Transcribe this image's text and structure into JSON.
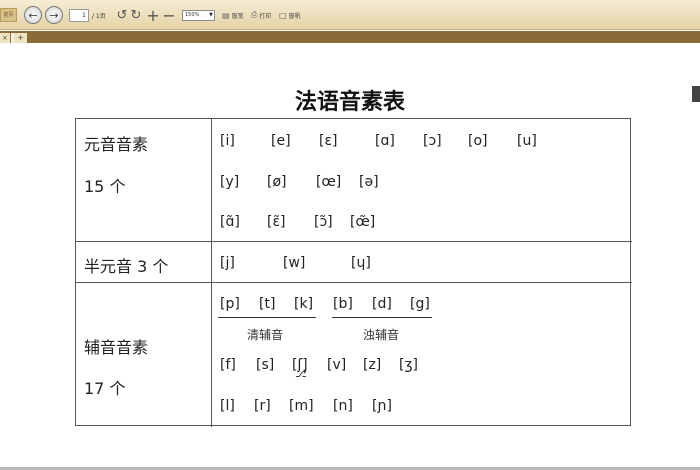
{
  "toolbar": {
    "prev_label": "前页",
    "page_input": "1",
    "page_total": "/ 1页",
    "zoom": "150%",
    "fit_label": "窗宽",
    "print_label": "打印",
    "fullscreen_label": "窗帆"
  },
  "tabs": {
    "close": "×",
    "add": "+"
  },
  "document": {
    "title": "法语音素表",
    "rows": [
      {
        "label": "元音音素",
        "count": "15 个",
        "lines": [
          [
            "[i]",
            "[e]",
            "[ɛ]",
            "[ɑ]",
            "[ɔ]",
            "[o]",
            "[u]"
          ],
          [
            "[y]",
            "[ø]",
            "[œ]",
            "[ə]"
          ],
          [
            "[ɑ̃]",
            "[ɛ̃]",
            "[ɔ̃]",
            "[œ̃]"
          ]
        ]
      },
      {
        "label": "半元音 3 个",
        "lines": [
          [
            "[j]",
            "[w]",
            "[ɥ]"
          ]
        ]
      },
      {
        "label": "辅音音素",
        "count": "17 个",
        "voiceless": [
          "[p]",
          "[t]",
          "[k]"
        ],
        "voiced": [
          "[b]",
          "[d]",
          "[g]"
        ],
        "voiceless_label": "清辅音",
        "voiced_label": "浊辅音",
        "lines": [
          [
            "[f]",
            "[s]",
            "[ʃ]",
            "[v]",
            "[z]",
            "[ʒ]"
          ],
          [
            "[l]",
            "[r]",
            "[m]",
            "[n]",
            "[ɲ]"
          ]
        ]
      }
    ]
  }
}
